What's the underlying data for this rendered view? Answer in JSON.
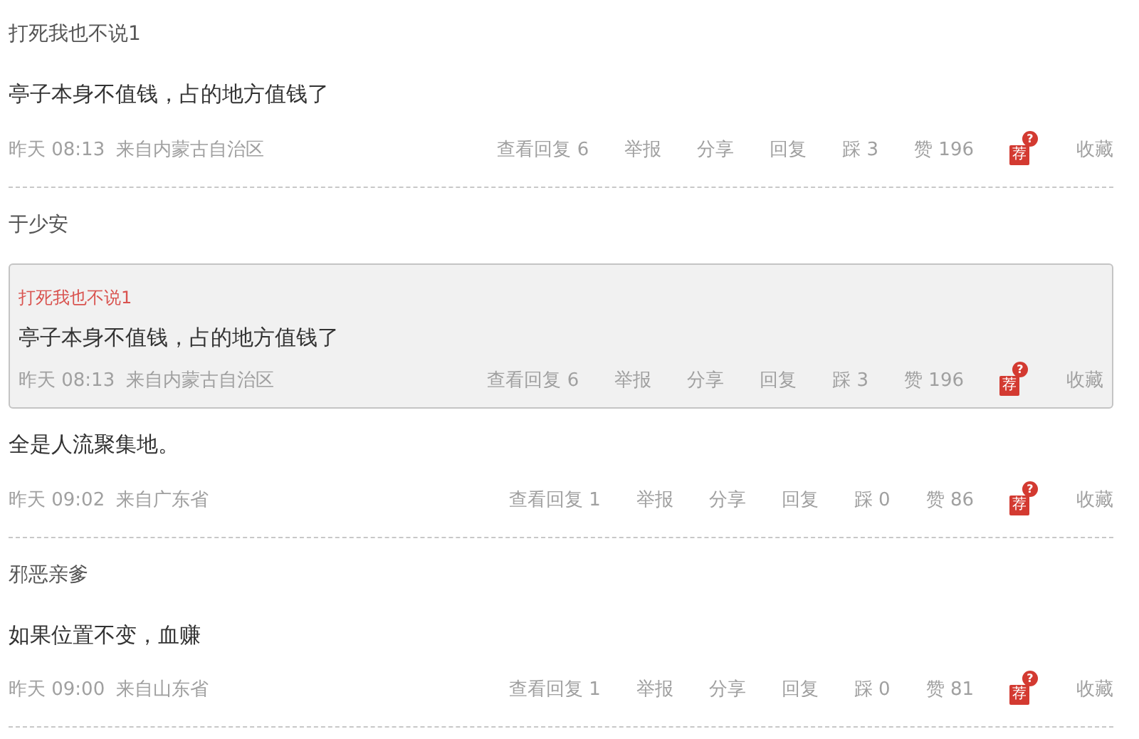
{
  "comments": [
    {
      "author": "打死我也不说1",
      "content": "亭子本身不值钱，占的地方值钱了",
      "time": "昨天 08:13",
      "location": "来自内蒙古自治区",
      "actions": [
        "查看回复 6",
        "举报",
        "分享",
        "回复",
        "踩 3",
        "赞 196"
      ],
      "recommend": {
        "glyph": "荐",
        "badge": "?"
      },
      "favorite": "收藏"
    },
    {
      "author": "于少安",
      "quote": {
        "author": "打死我也不说1",
        "content": "亭子本身不值钱，占的地方值钱了",
        "time": "昨天 08:13",
        "location": "来自内蒙古自治区",
        "actions": [
          "查看回复 6",
          "举报",
          "分享",
          "回复",
          "踩 3",
          "赞 196"
        ],
        "recommend": {
          "glyph": "荐",
          "badge": "?"
        },
        "favorite": "收藏"
      },
      "content": "全是人流聚集地。",
      "time": "昨天 09:02",
      "location": "来自广东省",
      "actions": [
        "查看回复 1",
        "举报",
        "分享",
        "回复",
        "踩 0",
        "赞 86"
      ],
      "recommend": {
        "glyph": "荐",
        "badge": "?"
      },
      "favorite": "收藏"
    },
    {
      "author": "邪恶亲爹",
      "content": "如果位置不变，血赚",
      "time": "昨天 09:00",
      "location": "来自山东省",
      "actions": [
        "查看回复 1",
        "举报",
        "分享",
        "回复",
        "踩 0",
        "赞 81"
      ],
      "recommend": {
        "glyph": "荐",
        "badge": "?"
      },
      "favorite": "收藏"
    }
  ]
}
